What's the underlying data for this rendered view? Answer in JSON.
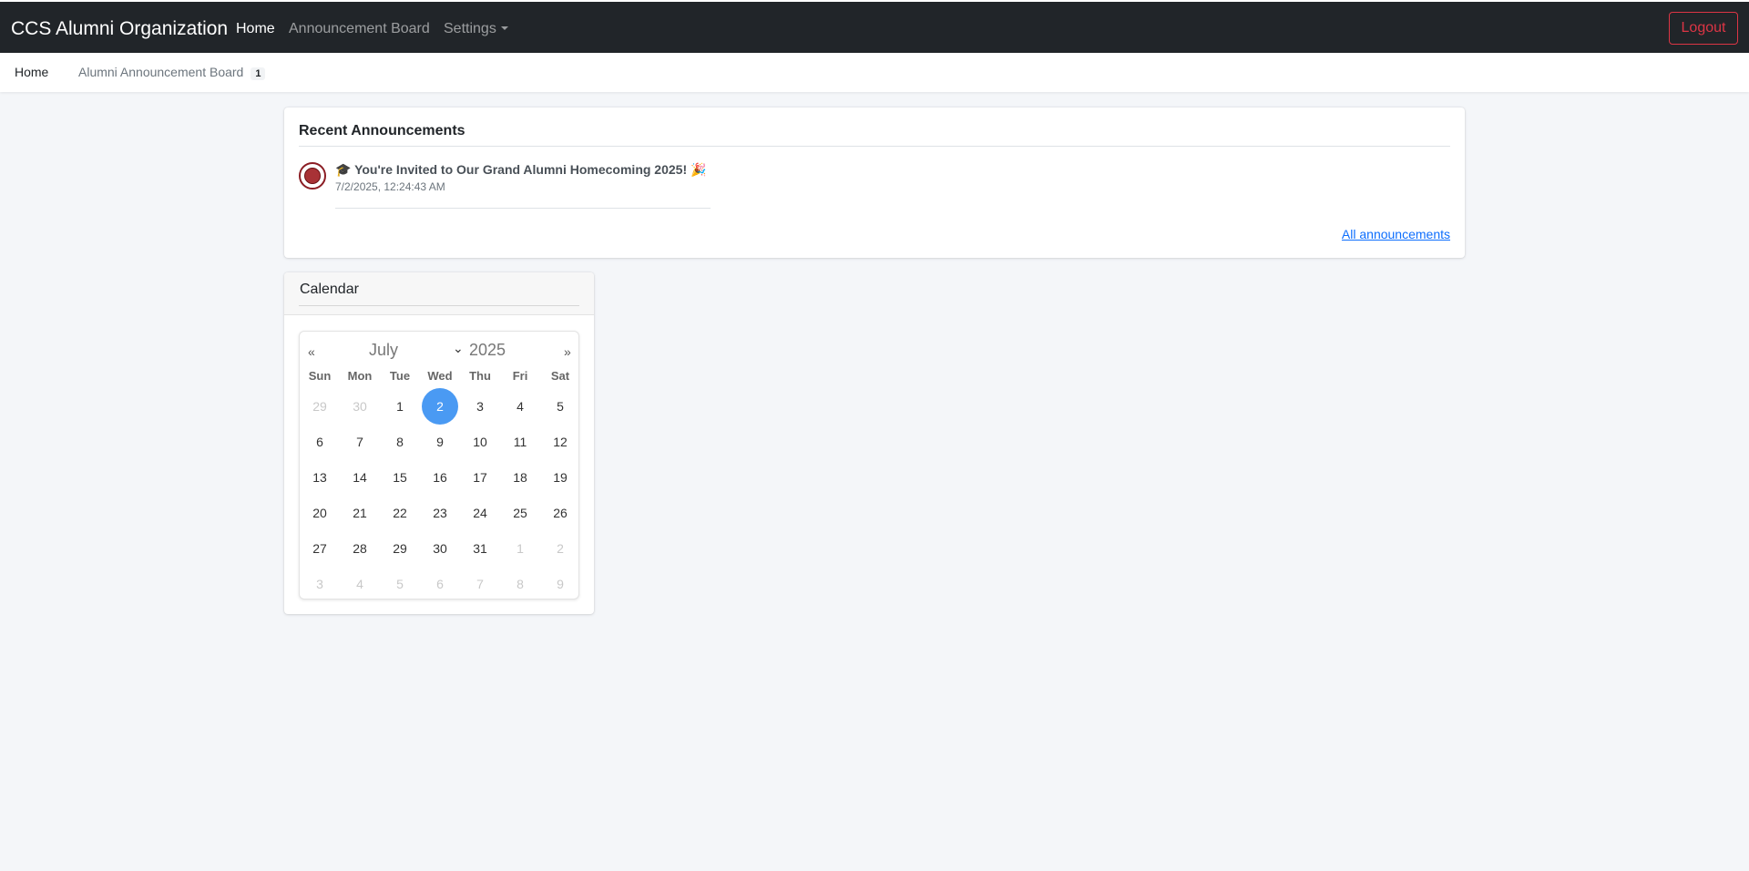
{
  "navbar": {
    "brand": "CCS Alumni Organization",
    "links": [
      "Home",
      "Announcement Board",
      "Settings"
    ],
    "logout": "Logout"
  },
  "subnav": {
    "home": "Home",
    "board": "Alumni Announcement Board",
    "board_badge": "1"
  },
  "announcements": {
    "title": "Recent Announcements",
    "items": [
      {
        "title": "🎓 You're Invited to Our Grand Alumni Homecoming 2025! 🎉",
        "date": "7/2/2025, 12:24:43 AM"
      }
    ],
    "all_link": "All announcements"
  },
  "calendar": {
    "title": "Calendar",
    "prev": "«",
    "next": "»",
    "month": "July",
    "year": "2025",
    "weekdays": [
      "Sun",
      "Mon",
      "Tue",
      "Wed",
      "Thu",
      "Fri",
      "Sat"
    ],
    "selected_day": 2,
    "weeks": [
      [
        "29",
        "30",
        "1",
        "2",
        "3",
        "4",
        "5"
      ],
      [
        "6",
        "7",
        "8",
        "9",
        "10",
        "11",
        "12"
      ],
      [
        "13",
        "14",
        "15",
        "16",
        "17",
        "18",
        "19"
      ],
      [
        "20",
        "21",
        "22",
        "23",
        "24",
        "25",
        "26"
      ],
      [
        "27",
        "28",
        "29",
        "30",
        "31",
        "1",
        "2"
      ],
      [
        "3",
        "4",
        "5",
        "6",
        "7",
        "8",
        "9"
      ]
    ],
    "accent_color": "#4a9af3"
  },
  "colors": {
    "navbar_bg": "#212529",
    "logout": "#dc3545",
    "link": "#0d6efd"
  }
}
